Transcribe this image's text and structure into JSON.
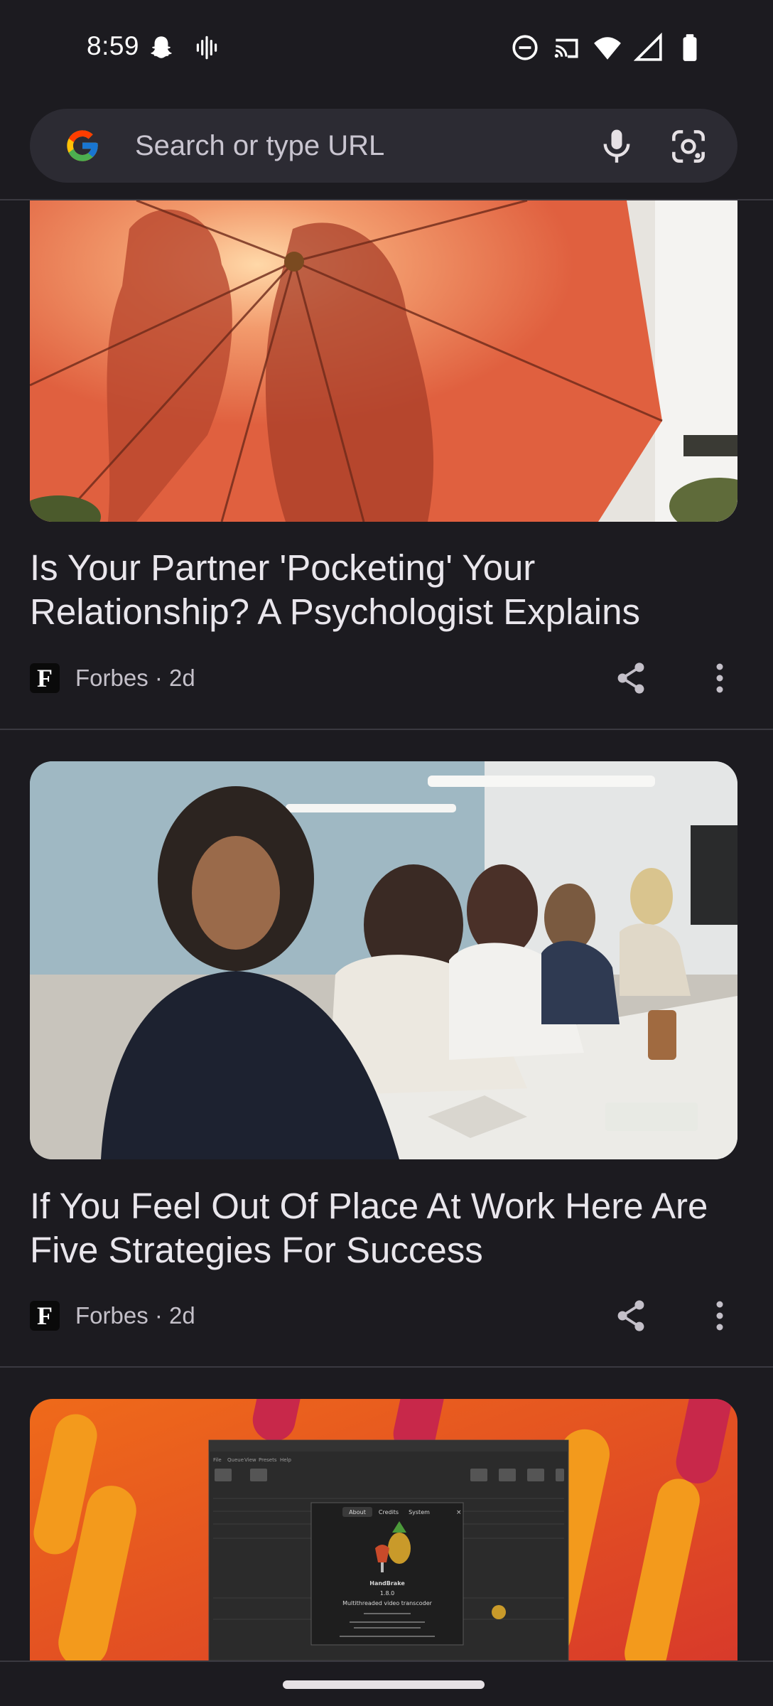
{
  "status_bar": {
    "time": "8:59",
    "left_icons": [
      "snapchat-icon",
      "voicemail-waveform-icon"
    ],
    "right_icons": [
      "do-not-disturb-icon",
      "cast-icon",
      "wifi-icon",
      "signal-icon",
      "battery-icon"
    ]
  },
  "search": {
    "placeholder": "Search or type URL"
  },
  "articles": [
    {
      "title": "Is Your Partner 'Pocketing' Your Relationship? A Psychologist Explains",
      "source_logo": "F",
      "source": "Forbes · 2d",
      "image": "silhouette-couple-under-red-umbrella"
    },
    {
      "title": "If You Feel Out Of Place At Work Here Are Five Strategies For Success",
      "source_logo": "F",
      "source": "Forbes · 2d",
      "image": "woman-at-office-meeting-table"
    },
    {
      "image": "handbrake-app-screenshot-on-orange",
      "dialog_tabs": [
        "About",
        "Credits",
        "System"
      ],
      "app_name": "HandBrake",
      "app_version": "1.8.0",
      "app_tagline": "Multithreaded video transcoder",
      "menu": [
        "File",
        "Queue",
        "View",
        "Presets",
        "Help"
      ]
    }
  ],
  "colors": {
    "background": "#1c1b20",
    "search_bar": "#2c2b33",
    "divider": "#3a3940"
  }
}
